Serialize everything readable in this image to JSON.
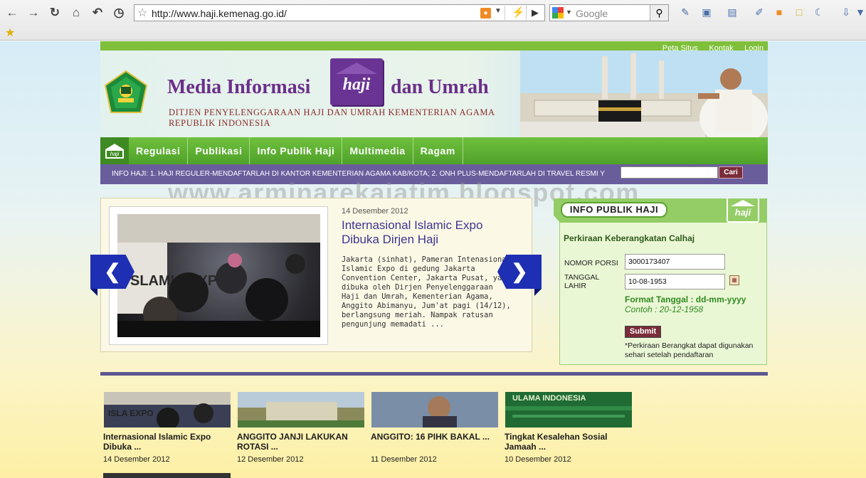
{
  "browser": {
    "url": "http://www.haji.kemenag.go.id/",
    "search_placeholder": "Google"
  },
  "site": {
    "toplinks": [
      "Peta Situs",
      "Kontak",
      "Login"
    ],
    "title_main": "Media Informasi",
    "title_logo": "haji",
    "title_tail": "dan Umrah",
    "subtitle_line1": "DITJEN PENYELENGGARAAN HAJI DAN UMRAH KEMENTERIAN AGAMA",
    "subtitle_line2": "REPUBLIK INDONESIA",
    "nav_home_logo": "haji",
    "nav": [
      "Regulasi",
      "Publikasi",
      "Info Publik Haji",
      "Multimedia",
      "Ragam"
    ],
    "ticker": "INFO HAJI: 1. HAJI REGULER-MENDAFTARLAH DI KANTOR KEMENTERIAN AGAMA KAB/KOTA; 2. ONH PLUS-MENDAFTARLAH DI TRAVEL RESMI Y",
    "ticker_button": "Cari",
    "watermark": "www.arminarekajatim.blogspot.com"
  },
  "slider": {
    "photo_text": "SLAMIC EXPO",
    "date": "14 Desember 2012",
    "title": "Internasional Islamic Expo Dibuka Dirjen Haji",
    "body": "Jakarta (sinhat), Pameran Intenasional Islamic Expo di gedung Jakarta Convention Center, Jakarta Pusat, yang dibuka oleh Dirjen Penyelenggaraan Haji dan Umrah, Kementerian Agama, Anggito Abimanyu, Jum'at pagi (14/12), berlangsung meriah. Nampak ratusan pengunjung memadati ..."
  },
  "info_box": {
    "header": "INFO PUBLIK HAJI",
    "logo": "haji",
    "subtitle": "Perkiraan Keberangkatan Calhaj",
    "label_porsi": "NOMOR PORSI",
    "label_tanggal": "TANGGAL LAHIR",
    "value_porsi": "3000173407",
    "value_tanggal": "10-08-1953",
    "format_label": "Format Tanggal : dd-mm-yyyy",
    "format_example": "Contoh : 20-12-1958",
    "submit": "Submit",
    "note": "*Perkiraan Berangkat dapat digunakan sehari setelah pendaftaran"
  },
  "news": [
    {
      "title": "Internasional Islamic Expo Dibuka ...",
      "date": "14 Desember 2012",
      "thumb_color": "#3a3f55",
      "thumb_text": "ISLA EXPO"
    },
    {
      "title": "ANGGITO JANJI LAKUKAN ROTASI ...",
      "date": "12 Desember 2012",
      "thumb_color": "#8a8a5c",
      "thumb_text": ""
    },
    {
      "title": "ANGGITO: 16 PIHK BAKAL ...",
      "date": "11 Desember 2012",
      "thumb_color": "#5a6e88",
      "thumb_text": ""
    },
    {
      "title": "Tingkat Kesalehan Sosial Jamaah ...",
      "date": "10 Desember 2012",
      "thumb_color": "#1f6b33",
      "thumb_text": "ULAMA INDONESIA"
    }
  ],
  "colors": {
    "nav_green": "#4fa22a",
    "ticker_purple": "#6a5d9c",
    "title_purple": "#6b2f8a",
    "arrow_blue": "#1e2fb3"
  }
}
